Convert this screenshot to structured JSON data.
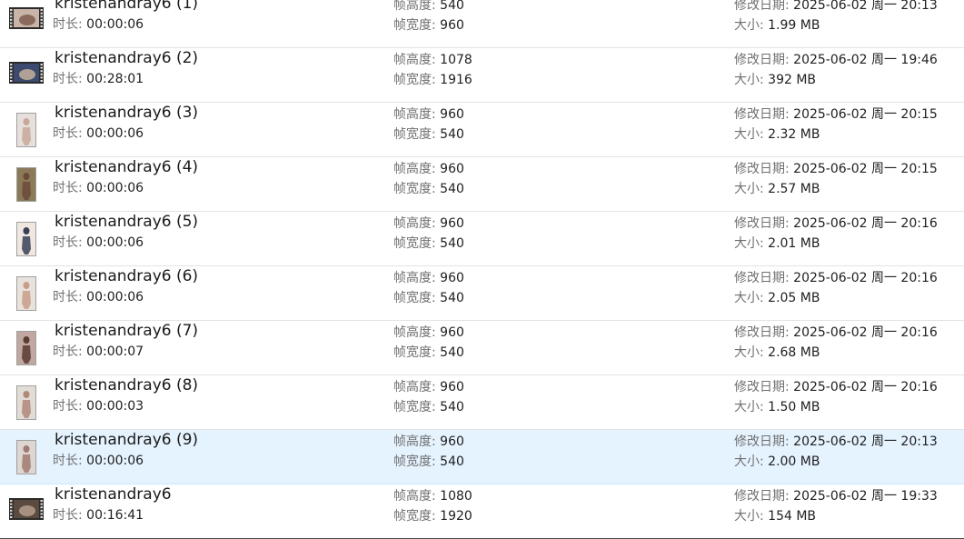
{
  "labels": {
    "duration": "时长: ",
    "frame_height": "帧高度: ",
    "frame_width": "帧宽度: ",
    "modified": "修改日期: ",
    "size": "大小: "
  },
  "files": [
    {
      "name": "kristenandray6 (1)",
      "duration": "00:00:06",
      "height": "540",
      "width": "960",
      "modified": "2025-06-02 周一 20:13",
      "size": "1.99 MB",
      "thumb": "landscape",
      "thumb_colors": [
        "#c9b4a8",
        "#8a6a5c"
      ],
      "selected": false
    },
    {
      "name": "kristenandray6 (2)",
      "duration": "00:28:01",
      "height": "1078",
      "width": "1916",
      "modified": "2025-06-02 周一 19:46",
      "size": "392 MB",
      "thumb": "landscape",
      "thumb_colors": [
        "#3b4a6e",
        "#b0a096"
      ],
      "selected": false
    },
    {
      "name": "kristenandray6 (3)",
      "duration": "00:00:06",
      "height": "960",
      "width": "540",
      "modified": "2025-06-02 周一 20:15",
      "size": "2.32 MB",
      "thumb": "portrait",
      "thumb_colors": [
        "#e6e0dc",
        "#c8a898"
      ],
      "selected": false
    },
    {
      "name": "kristenandray6 (4)",
      "duration": "00:00:06",
      "height": "960",
      "width": "540",
      "modified": "2025-06-02 周一 20:15",
      "size": "2.57 MB",
      "thumb": "portrait",
      "thumb_colors": [
        "#8a7a58",
        "#6b4a3a"
      ],
      "selected": false
    },
    {
      "name": "kristenandray6 (5)",
      "duration": "00:00:06",
      "height": "960",
      "width": "540",
      "modified": "2025-06-02 周一 20:16",
      "size": "2.01 MB",
      "thumb": "portrait",
      "thumb_colors": [
        "#efe8e0",
        "#3a4058"
      ],
      "selected": false
    },
    {
      "name": "kristenandray6 (6)",
      "duration": "00:00:06",
      "height": "960",
      "width": "540",
      "modified": "2025-06-02 周一 20:16",
      "size": "2.05 MB",
      "thumb": "portrait",
      "thumb_colors": [
        "#e8e2dc",
        "#c89e8a"
      ],
      "selected": false
    },
    {
      "name": "kristenandray6 (7)",
      "duration": "00:00:07",
      "height": "960",
      "width": "540",
      "modified": "2025-06-02 周一 20:16",
      "size": "2.68 MB",
      "thumb": "portrait",
      "thumb_colors": [
        "#c0a8a0",
        "#5a3a34"
      ],
      "selected": false
    },
    {
      "name": "kristenandray6 (8)",
      "duration": "00:00:03",
      "height": "960",
      "width": "540",
      "modified": "2025-06-02 周一 20:16",
      "size": "1.50 MB",
      "thumb": "portrait",
      "thumb_colors": [
        "#e2dcd6",
        "#b08878"
      ],
      "selected": false
    },
    {
      "name": "kristenandray6 (9)",
      "duration": "00:00:06",
      "height": "960",
      "width": "540",
      "modified": "2025-06-02 周一 20:13",
      "size": "2.00 MB",
      "thumb": "portrait",
      "thumb_colors": [
        "#ddd6d2",
        "#a07a70"
      ],
      "selected": true
    },
    {
      "name": "kristenandray6",
      "duration": "00:16:41",
      "height": "1080",
      "width": "1920",
      "modified": "2025-06-02 周一 19:33",
      "size": "154 MB",
      "thumb": "landscape",
      "thumb_colors": [
        "#5a4a40",
        "#a89080"
      ],
      "selected": false
    }
  ],
  "colors": {
    "selected_row": "#e5f3ff",
    "separator": "#e3e3e3"
  }
}
